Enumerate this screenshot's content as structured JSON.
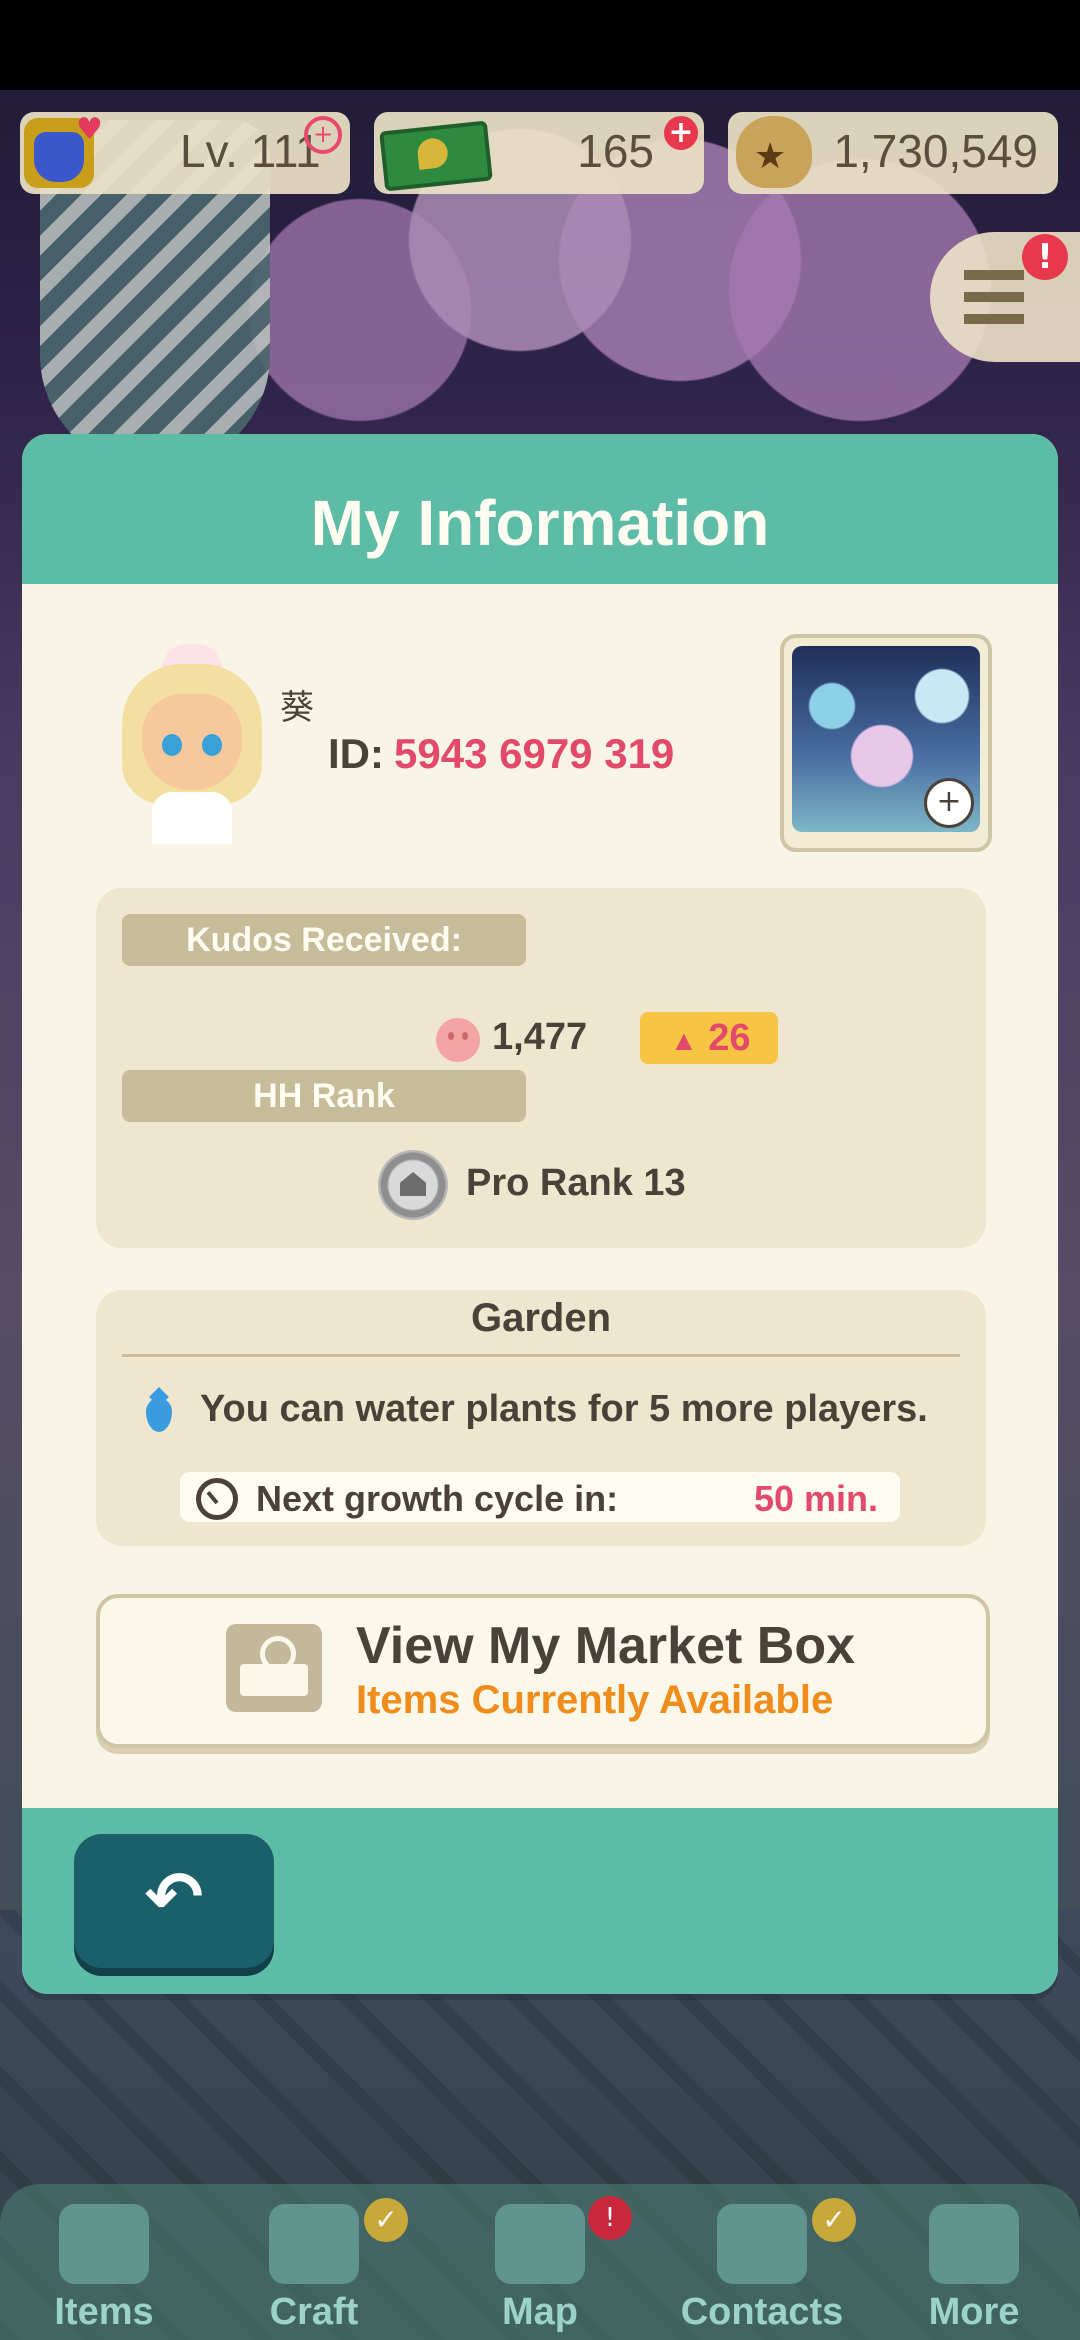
{
  "hud": {
    "level": "Lv. 111",
    "leaf_tickets": "165",
    "bells": "1,730,549"
  },
  "dialog": {
    "title": "My Information",
    "player": {
      "name": "葵",
      "id_label": "ID:",
      "id_value": "5943 6979 319"
    },
    "stats": {
      "kudos_label": "Kudos Received:",
      "kudos_value": "1,477",
      "kudos_delta": "26",
      "rank_label": "HH Rank",
      "rank_value": "Pro Rank 13"
    },
    "garden": {
      "title": "Garden",
      "water_text": "You can water plants for 5 more players.",
      "growth_label": "Next growth cycle in:",
      "growth_value": "50 min."
    },
    "market": {
      "title": "View My Market Box",
      "subtitle": "Items Currently Available"
    }
  },
  "nav": {
    "items": [
      {
        "label": "Items",
        "icon": "bag-icon"
      },
      {
        "label": "Craft",
        "icon": "hammer-icon"
      },
      {
        "label": "Map",
        "icon": "map-icon"
      },
      {
        "label": "Contacts",
        "icon": "cat-icon"
      },
      {
        "label": "More",
        "icon": "grid-icon"
      }
    ]
  },
  "colors": {
    "teal": "#5dbca6",
    "accent_pink": "#e2496a",
    "accent_orange": "#f08c1b",
    "panel": "#efe6cf"
  }
}
